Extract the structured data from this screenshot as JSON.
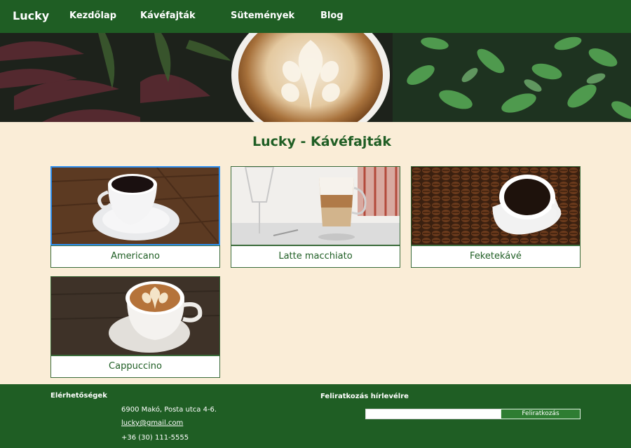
{
  "nav": {
    "brand": "Lucky",
    "links": [
      "Kezdőlap",
      "Kávéfajták",
      "Sütemények",
      "Blog"
    ]
  },
  "page": {
    "title": "Lucky - Kávéfajták"
  },
  "coffees": [
    {
      "name": "Americano",
      "selected": true
    },
    {
      "name": "Latte macchiato",
      "selected": false
    },
    {
      "name": "Feketekávé",
      "selected": false
    },
    {
      "name": "Cappuccino",
      "selected": false
    }
  ],
  "footer": {
    "contact_heading": "Elérhetőségek",
    "address": "6900 Makó, Posta utca 4-6.",
    "email": "lucky@gmail.com",
    "phone": "+36 (30) 111-5555",
    "newsletter_heading": "Feliratkozás hírlevélre",
    "newsletter_input_value": "",
    "newsletter_button": "Feliratkozás"
  },
  "colors": {
    "brand_green": "#1f5e24",
    "background": "#faedd7",
    "selection_border": "#2e90f0"
  }
}
